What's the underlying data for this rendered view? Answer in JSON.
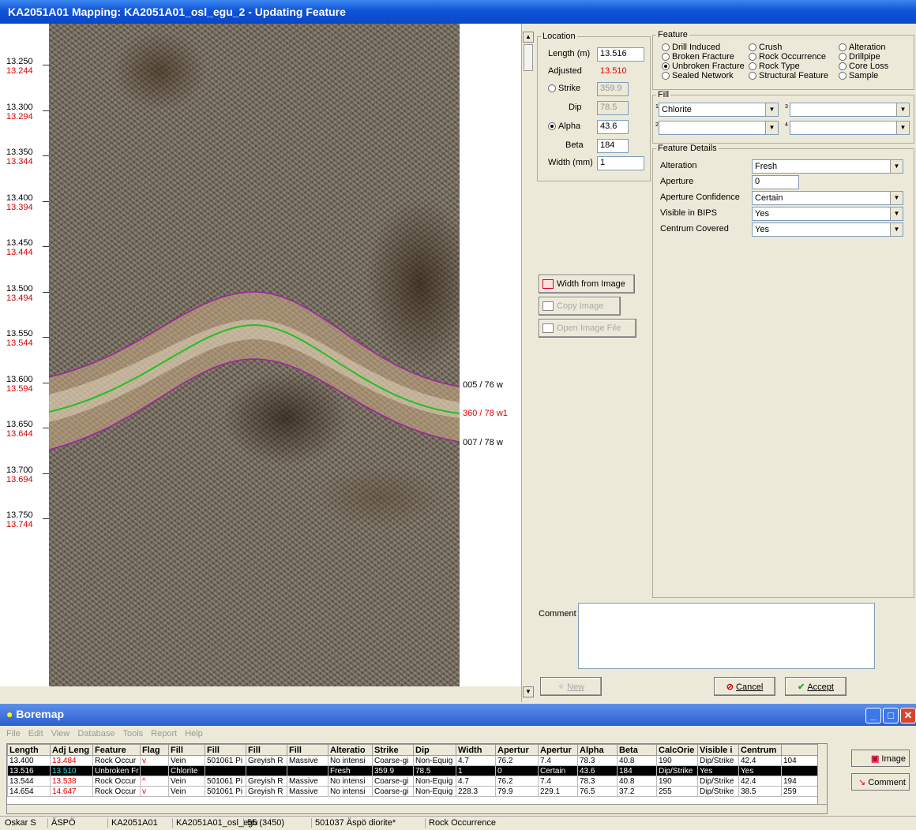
{
  "title": "KA2051A01 Mapping: KA2051A01_osl_egu_2 - Updating Feature",
  "depths": [
    {
      "a": "13.250",
      "b": "13.244"
    },
    {
      "a": "13.300",
      "b": "13.294"
    },
    {
      "a": "13.350",
      "b": "13.344"
    },
    {
      "a": "13.400",
      "b": "13.394"
    },
    {
      "a": "13.450",
      "b": "13.444"
    },
    {
      "a": "13.500",
      "b": "13.494"
    },
    {
      "a": "13.550",
      "b": "13.544"
    },
    {
      "a": "13.600",
      "b": "13.594"
    },
    {
      "a": "13.650",
      "b": "13.644"
    },
    {
      "a": "13.700",
      "b": "13.694"
    },
    {
      "a": "13.750",
      "b": "13.744"
    }
  ],
  "traces": [
    {
      "label": "005 / 76 w",
      "color": "#a020a0"
    },
    {
      "label": "360 / 78 w1",
      "color": "#e00000"
    },
    {
      "label": "007 / 78 w",
      "color": "#a020a0"
    }
  ],
  "location": {
    "legend": "Location",
    "length_label": "Length (m)",
    "length": "13.516",
    "adjusted_label": "Adjusted",
    "adjusted": "13.510",
    "strike_label": "Strike",
    "strike": "359.9",
    "dip_label": "Dip",
    "dip": "78.5",
    "alpha_label": "Alpha",
    "alpha": "43.6",
    "beta_label": "Beta",
    "beta": "184",
    "width_label": "Width (mm)",
    "width": "1"
  },
  "feature": {
    "legend": "Feature",
    "options": [
      "Drill Induced",
      "Crush",
      "Alteration",
      "Broken Fracture",
      "Rock Occurrence",
      "Drillpipe",
      "Unbroken Fracture",
      "Rock Type",
      "Core Loss",
      "Sealed Network",
      "Structural Feature",
      "Sample"
    ]
  },
  "fill": {
    "legend": "Fill",
    "slot1_num": "1",
    "slot1": "Chlorite",
    "slot2_num": "2",
    "slot3_num": "3",
    "slot4_num": "4"
  },
  "details": {
    "legend": "Feature Details",
    "rows": [
      {
        "label": "Alteration",
        "value": "Fresh",
        "type": "select"
      },
      {
        "label": "Aperture",
        "value": "0",
        "type": "text"
      },
      {
        "label": "Aperture Confidence",
        "value": "Certain",
        "type": "select"
      },
      {
        "label": "Visible in BIPS",
        "value": "Yes",
        "type": "select"
      },
      {
        "label": "Centrum Covered",
        "value": "Yes",
        "type": "select"
      }
    ]
  },
  "buttons": {
    "width_from_image": "Width from Image",
    "copy_image": "Copy Image",
    "open_image_file": "Open Image File",
    "new": "New",
    "cancel": "Cancel",
    "accept": "Accept"
  },
  "comment_label": "Comment",
  "boremap": {
    "title": "Boremap",
    "menu": [
      "File",
      "Edit",
      "View",
      "Database",
      "Tools",
      "Report",
      "Help"
    ],
    "columns": [
      "Length",
      "Adj Leng",
      "Feature",
      "Flag",
      "Fill",
      "Fill",
      "Fill",
      "Fill",
      "Alteratio",
      "Strike",
      "Dip",
      "Width",
      "Apertur",
      "Apertur",
      "Alpha",
      "Beta",
      "CalcOrie",
      "Visible i",
      "Centrum",
      ""
    ],
    "rows": [
      [
        "13.400",
        "13.484",
        "Rock Occur",
        "v",
        "Vein",
        "501061 Pi",
        "Greyish R",
        "Massive",
        "No intensi",
        "Coarse-gi",
        "Non-Equig",
        "4.7",
        "76.2",
        "7.4",
        "78.3",
        "40.8",
        "190",
        "Dip/Strike",
        "42.4",
        "104"
      ],
      [
        "13.516",
        "13.510",
        "Unbroken Fr",
        "",
        "Chlorite",
        "",
        "",
        "",
        "Fresh",
        "359.9",
        "78.5",
        "1",
        "0",
        "Certain",
        "43.6",
        "184",
        "Dip/Strike",
        "Yes",
        "Yes",
        ""
      ],
      [
        "13.544",
        "13.538",
        "Rock Occur",
        "^",
        "Vein",
        "501061 Pi",
        "Greyish R",
        "Massive",
        "No intensi",
        "Coarse-gi",
        "Non-Equig",
        "4.7",
        "76.2",
        "7.4",
        "78.3",
        "40.8",
        "190",
        "Dip/Strike",
        "42.4",
        "194"
      ],
      [
        "14.654",
        "14.647",
        "Rock Occur",
        "v",
        "Vein",
        "501061 Pi",
        "Greyish R",
        "Massive",
        "No intensi",
        "Coarse-gi",
        "Non-Equig",
        "228.3",
        "79.9",
        "229.1",
        "76.5",
        "37.2",
        "255",
        "Dip/Strike",
        "38.5",
        "259"
      ]
    ],
    "image_btn": "Image",
    "comment_btn": "Comment"
  },
  "status": [
    "Oskar S",
    "ÄSPÖ",
    "KA2051A01",
    "KA2051A01_osl_egu",
    "55 (3450)",
    "501037 Äspö diorite*",
    "Rock Occurrence"
  ]
}
